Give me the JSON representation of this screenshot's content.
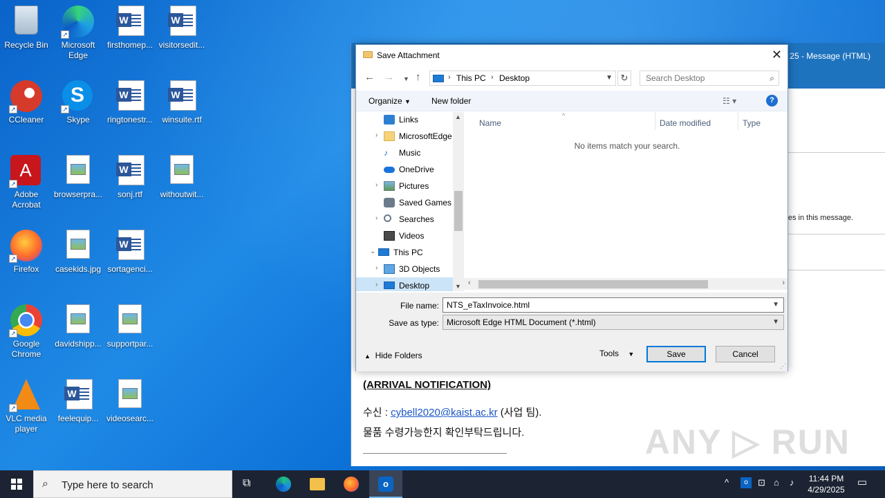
{
  "desktop": {
    "icons": [
      {
        "label": "Recycle Bin",
        "icon": "recycle-bin-icon"
      },
      {
        "label": "Microsoft Edge",
        "icon": "edge-icon"
      },
      {
        "label": "firsthomep...",
        "icon": "word-document-icon"
      },
      {
        "label": "visitorsedit...",
        "icon": "word-document-icon"
      },
      {
        "label": "CCleaner",
        "icon": "ccleaner-icon"
      },
      {
        "label": "Skype",
        "icon": "skype-icon"
      },
      {
        "label": "ringtonestr...",
        "icon": "word-document-icon"
      },
      {
        "label": "winsuite.rtf",
        "icon": "word-document-icon"
      },
      {
        "label": "Adobe Acrobat",
        "icon": "acrobat-icon"
      },
      {
        "label": "browserpra...",
        "icon": "image-file-icon"
      },
      {
        "label": "sonj.rtf",
        "icon": "word-document-icon"
      },
      {
        "label": "withoutwit...",
        "icon": "image-file-icon"
      },
      {
        "label": "Firefox",
        "icon": "firefox-icon"
      },
      {
        "label": "casekids.jpg",
        "icon": "image-file-icon"
      },
      {
        "label": "sortagenci...",
        "icon": "word-document-icon"
      },
      {
        "label": "Google Chrome",
        "icon": "chrome-icon"
      },
      {
        "label": "davidshipp...",
        "icon": "image-file-icon"
      },
      {
        "label": "supportpar...",
        "icon": "image-file-icon"
      },
      {
        "label": "VLC media player",
        "icon": "vlc-icon"
      },
      {
        "label": "feelequip...",
        "icon": "word-document-icon"
      },
      {
        "label": "videosearc...",
        "icon": "image-file-icon"
      }
    ]
  },
  "outlook": {
    "title_partial": "25  -  Message (HTML)",
    "info_partial": "es in this message.",
    "mail": {
      "heading": "(ARRIVAL NOTIFICATION)",
      "recipient_prefix": "수신 : ",
      "recipient_email": "cybell2020@kaist.ac.kr",
      "recipient_suffix": " (사업 팀).",
      "line2": "물품 수령가능한지 확인부탁드립니다."
    },
    "watermark": "ANY RUN"
  },
  "dialog": {
    "title": "Save Attachment",
    "address": {
      "segments": [
        "This PC",
        "Desktop"
      ]
    },
    "search_placeholder": "Search Desktop",
    "toolbar": {
      "organize": "Organize",
      "new_folder": "New folder"
    },
    "nav_items": [
      {
        "label": "Links",
        "icon": "links-folder-icon",
        "expandable": false,
        "level": 1
      },
      {
        "label": "MicrosoftEdge",
        "icon": "folder-icon",
        "expandable": true,
        "level": 1
      },
      {
        "label": "Music",
        "icon": "music-folder-icon",
        "expandable": false,
        "level": 1
      },
      {
        "label": "OneDrive",
        "icon": "onedrive-icon",
        "expandable": false,
        "level": 1
      },
      {
        "label": "Pictures",
        "icon": "pictures-folder-icon",
        "expandable": true,
        "level": 1
      },
      {
        "label": "Saved Games",
        "icon": "saved-games-icon",
        "expandable": false,
        "level": 1
      },
      {
        "label": "Searches",
        "icon": "searches-icon",
        "expandable": true,
        "level": 1
      },
      {
        "label": "Videos",
        "icon": "videos-folder-icon",
        "expandable": false,
        "level": 1
      },
      {
        "label": "This PC",
        "icon": "this-pc-icon",
        "expandable": true,
        "expanded": true,
        "level": 0
      },
      {
        "label": "3D Objects",
        "icon": "3d-objects-icon",
        "expandable": true,
        "level": 1
      },
      {
        "label": "Desktop",
        "icon": "desktop-folder-icon",
        "expandable": true,
        "level": 1,
        "selected": true
      }
    ],
    "columns": [
      "Name",
      "Date modified",
      "Type"
    ],
    "empty_message": "No items match your search.",
    "file_name_label": "File name:",
    "file_name_value": "NTS_eTaxInvoice.html",
    "save_type_label": "Save as type:",
    "save_type_value": "Microsoft Edge HTML Document (*.html)",
    "hide_folders": "Hide Folders",
    "tools": "Tools",
    "save": "Save",
    "cancel": "Cancel"
  },
  "taskbar": {
    "search_placeholder": "Type here to search",
    "time": "11:44 PM",
    "date": "4/29/2025"
  }
}
